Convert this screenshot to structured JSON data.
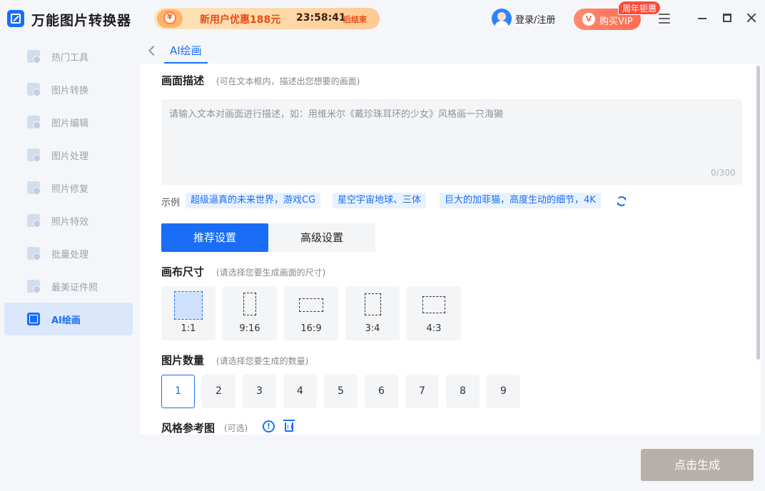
{
  "app": {
    "title": "万能图片转换器"
  },
  "promo": {
    "text": "新用户优惠188元",
    "countdown": "23:58:41",
    "suffix": "后结束"
  },
  "header": {
    "login_label": "登录/注册",
    "vip_label": "购买VIP",
    "vip_badge": "周年钜惠"
  },
  "sidebar": {
    "items": [
      {
        "label": "热门工具",
        "icon": "hot-tools-icon"
      },
      {
        "label": "图片转换",
        "icon": "image-convert-icon"
      },
      {
        "label": "图片编辑",
        "icon": "image-edit-icon"
      },
      {
        "label": "图片处理",
        "icon": "image-process-icon"
      },
      {
        "label": "照片修复",
        "icon": "photo-repair-icon"
      },
      {
        "label": "照片特效",
        "icon": "photo-effects-icon"
      },
      {
        "label": "批量处理",
        "icon": "batch-process-icon"
      },
      {
        "label": "最美证件照",
        "icon": "id-photo-icon"
      },
      {
        "label": "AI绘画",
        "icon": "ai-paint-icon",
        "active": true
      }
    ]
  },
  "tabs": {
    "current": "AI绘画"
  },
  "description": {
    "title": "画面描述",
    "hint": "(可在文本框内，描述出您想要的画面)",
    "placeholder": "请输入文本对画面进行描述，如：用维米尔《戴珍珠耳环的少女》风格画一只海獭",
    "value": "",
    "count": "0/300"
  },
  "examples": {
    "label": "示例",
    "items": [
      "超级逼真的未来世界，游戏CG",
      "星空宇宙地球、三体",
      "巨大的加菲猫，高度生动的细节，4K"
    ]
  },
  "settings_modes": {
    "recommended": "推荐设置",
    "advanced": "高级设置"
  },
  "canvas_size": {
    "title": "画布尺寸",
    "hint": "(请选择您要生成画面的尺寸)",
    "options": [
      "1:1",
      "9:16",
      "16:9",
      "3:4",
      "4:3"
    ],
    "selected": "1:1"
  },
  "image_count": {
    "title": "图片数量",
    "hint": "(请选择您要生成的数量)",
    "options": [
      "1",
      "2",
      "3",
      "4",
      "5",
      "6",
      "7",
      "8",
      "9"
    ],
    "selected": "1"
  },
  "style_ref": {
    "title": "风格参考图",
    "hint": "(可选)",
    "info_glyph": "!"
  },
  "generate": {
    "label": "点击生成"
  },
  "colors": {
    "accent": "#1a6ef5",
    "generate_disabled": "#b7b0aa",
    "promo_text": "#e94a12",
    "vip": "#ff6a50"
  }
}
